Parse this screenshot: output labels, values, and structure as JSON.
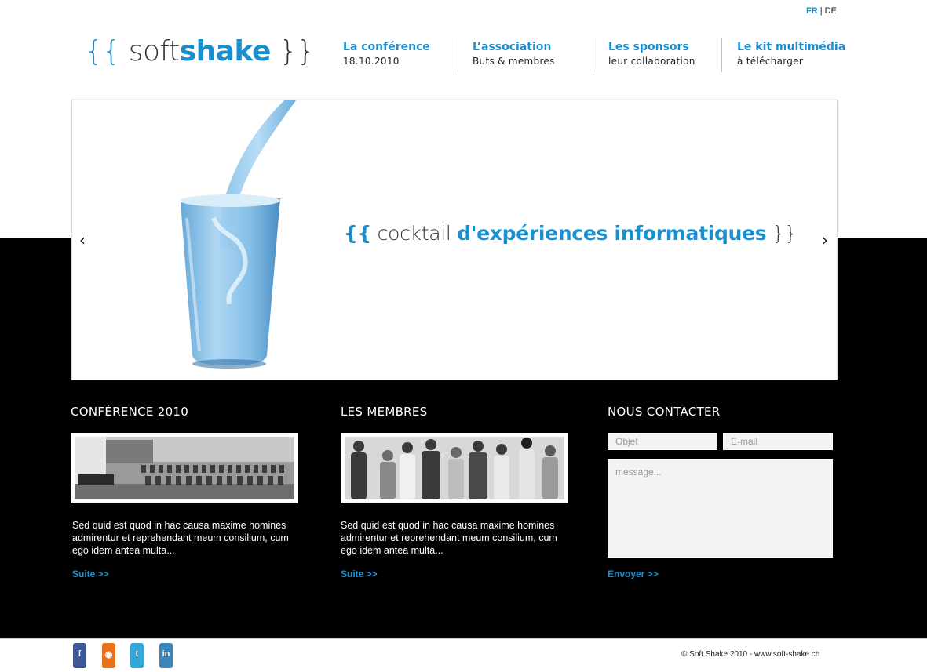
{
  "lang": {
    "active": "FR",
    "separator": "|",
    "other": "DE"
  },
  "logo": {
    "brace_open": "{{",
    "soft": "soft",
    "shake": "shake",
    "brace_close": "}}"
  },
  "nav": [
    {
      "title": "La conférence",
      "subtitle": "18.10.2010"
    },
    {
      "title": "L’association",
      "subtitle": "Buts & membres"
    },
    {
      "title": "Les sponsors",
      "subtitle": "leur collaboration"
    },
    {
      "title": "Le kit multimédia",
      "subtitle": "à télécharger"
    }
  ],
  "slider": {
    "prev": "‹",
    "next": "›",
    "tagline": {
      "brace_open": "{{",
      "word1": "cocktail",
      "word2": "d'expériences informatiques",
      "brace_close": "}}"
    }
  },
  "columns": [
    {
      "title": "CONFÉRENCE 2010",
      "text": "Sed quid est quod in hac causa maxime homines admirentur et reprehendant meum consilium, cum ego idem antea multa...",
      "more": "Suite >>"
    },
    {
      "title": "LES MEMBRES",
      "text": "Sed quid est quod in hac causa maxime homines admirentur et reprehendant meum consilium, cum ego idem antea multa...",
      "more": "Suite >>"
    }
  ],
  "contact": {
    "title": "NOUS CONTACTER",
    "subject_placeholder": "Objet",
    "email_placeholder": "E-mail",
    "message_placeholder": "message...",
    "submit": "Envoyer >>"
  },
  "social": [
    {
      "icon": "facebook-icon",
      "glyph": "f",
      "color": "#3b5998"
    },
    {
      "icon": "rss-icon",
      "glyph": "◉",
      "color": "#e8721c"
    },
    {
      "icon": "twitter-icon",
      "glyph": "t",
      "color": "#33a8d8"
    },
    {
      "icon": "linkedin-icon",
      "glyph": "in",
      "color": "#3a84b6"
    }
  ],
  "footer": {
    "copyright": "© Soft Shake 2010 - www.soft-shake.ch"
  }
}
